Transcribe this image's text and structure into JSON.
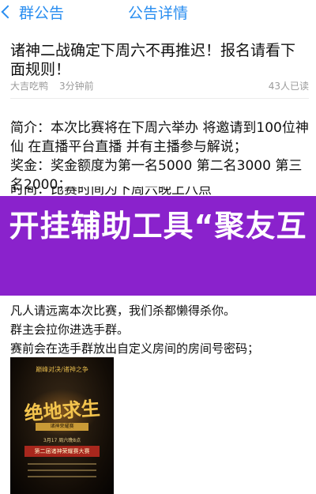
{
  "nav": {
    "back_label": "群公告",
    "title": "公告详情"
  },
  "post": {
    "title": "诸神二战确定下周六不再推迟！报名请看下面规则！",
    "author": "大吉吃鸭",
    "time": "3分钟前",
    "reads": "43人已读"
  },
  "content": {
    "intro": "简介：本次比赛将在下周六举办 将邀请到100位神仙 在直播平台直播 并有主播参与解说；",
    "prize": "奖金：奖金额度为第一名5000 第二名3000 第三名2000；",
    "partial_line": "时间：比赛时间为下周六晚上八点"
  },
  "banner": {
    "text": "开挂辅助工具“聚友互",
    "color": "#8a22cc"
  },
  "rules": {
    "line1": "凡人请远离本次比赛，我们杀都懒得杀你。",
    "line2": "群主会拉你进选手群。",
    "line3": "赛前会在选手群放出自定义房间的房间号密码；"
  },
  "poster": {
    "top_text": "巅峰对决/诸神之争",
    "title": "绝地求生",
    "subtitle": "诸神荣耀赛",
    "date": "3月17 周六晚8点",
    "band": "第二届诸神荣耀赛大赛"
  },
  "colors": {
    "accent": "#2a8ef0",
    "meta_gray": "#9b9b9b"
  },
  "icons": {
    "back": "chevron-left-icon"
  }
}
